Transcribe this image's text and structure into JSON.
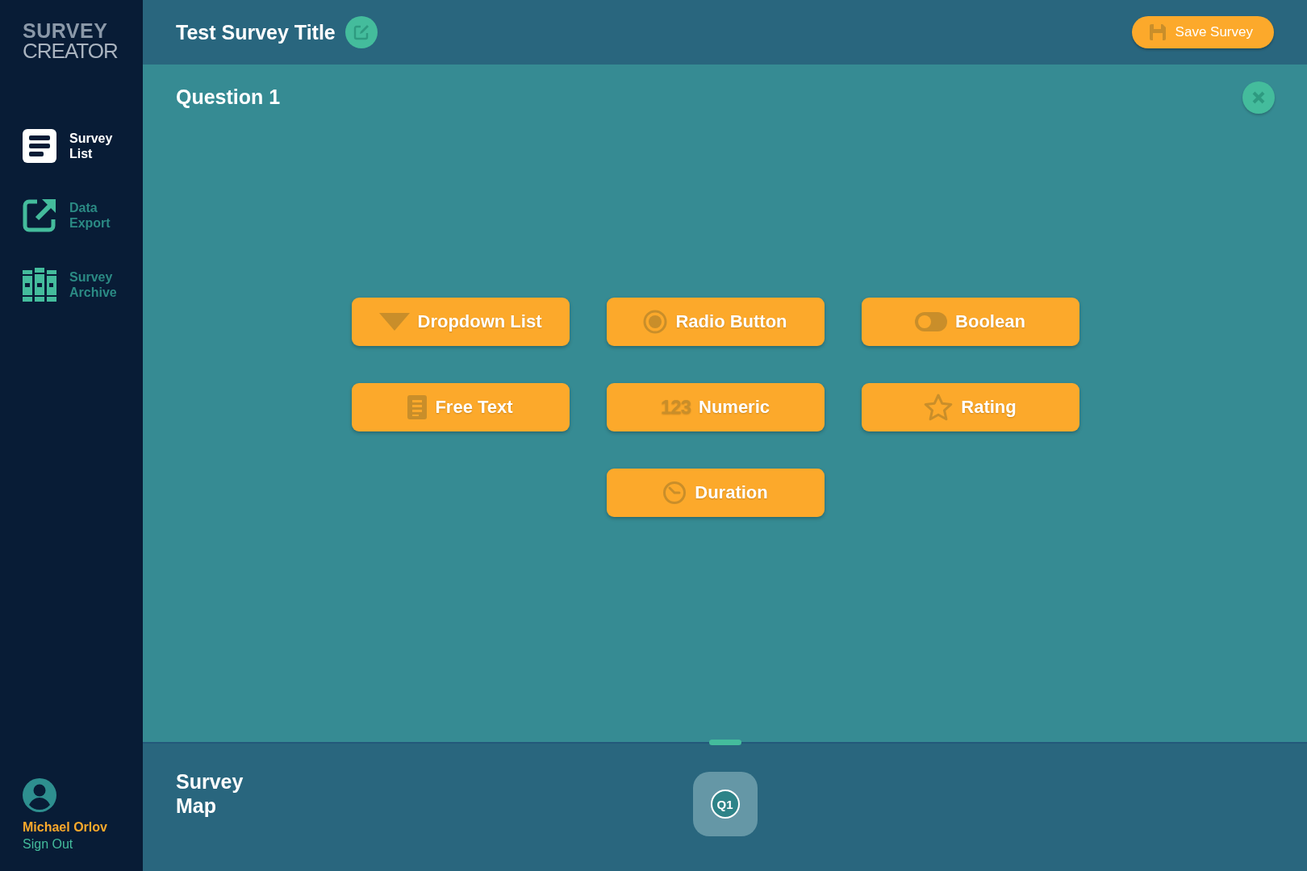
{
  "brand": {
    "line_1": "SURVEY",
    "line_2": "CREATOR"
  },
  "sidebar": {
    "items": [
      {
        "kind": "list",
        "label": "Survey List",
        "selected": true
      },
      {
        "kind": "export",
        "label": "Data Export",
        "selected": false
      },
      {
        "kind": "archive",
        "label": "Survey Archive",
        "selected": false
      }
    ],
    "user": {
      "name": "Michael Orlov",
      "action": "Sign Out"
    }
  },
  "header": {
    "title": "Test Survey Title",
    "save_button": "Save Survey"
  },
  "question": {
    "title": "Question 1",
    "types": [
      {
        "kind": "dropdown",
        "label": "Dropdown List"
      },
      {
        "kind": "radio",
        "label": "Radio Button"
      },
      {
        "kind": "boolean",
        "label": "Boolean"
      },
      {
        "kind": "text",
        "label": "Free Text"
      },
      {
        "kind": "numeric",
        "label": "Numeric",
        "icon_text": "123"
      },
      {
        "kind": "rating",
        "label": "Rating"
      },
      {
        "kind": "duration",
        "label": "Duration"
      }
    ]
  },
  "survey_map": {
    "title": "Survey Map",
    "nodes": [
      {
        "label": "Q1"
      }
    ]
  }
}
